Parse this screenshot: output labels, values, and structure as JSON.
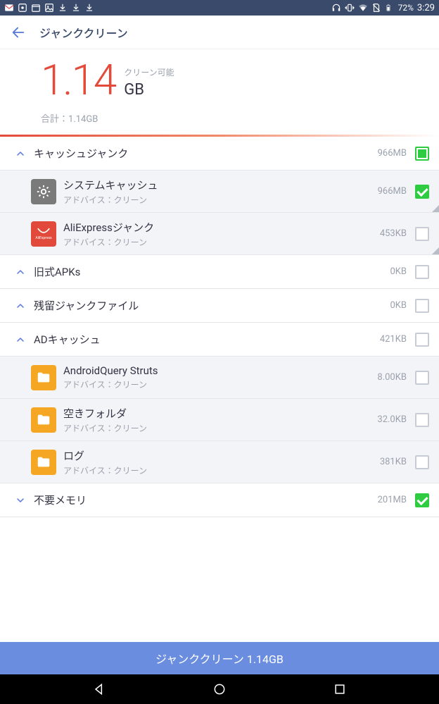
{
  "status_bar": {
    "battery_pct": "72%",
    "clock": "3:29"
  },
  "header": {
    "title": "ジャンククリーン"
  },
  "summary": {
    "big_number": "1.14",
    "cleanable_label": "クリーン可能",
    "unit": "GB",
    "total_label": "合計：",
    "total_value": "1.14GB"
  },
  "advice_text": "アドバイス：クリーン",
  "categories": [
    {
      "id": "cache",
      "label": "キャッシュジャンク",
      "size": "966MB",
      "expanded": true,
      "check": "partial",
      "items": [
        {
          "id": "system-cache",
          "icon": "gear",
          "label": "システムキャッシュ",
          "size": "966MB",
          "check": "checked",
          "tri": true
        },
        {
          "id": "aliexpress",
          "icon": "ali",
          "label": "AliExpressジャンク",
          "size": "453KB",
          "check": "unchecked",
          "tri": true
        }
      ]
    },
    {
      "id": "old-apks",
      "label": "旧式APKs",
      "size": "0KB",
      "expanded": true,
      "check": "unchecked",
      "items": []
    },
    {
      "id": "residual",
      "label": "残留ジャンクファイル",
      "size": "0KB",
      "expanded": true,
      "check": "unchecked",
      "items": []
    },
    {
      "id": "ad-cache",
      "label": "ADキャッシュ",
      "size": "421KB",
      "expanded": true,
      "check": "unchecked",
      "items": [
        {
          "id": "aq-struts",
          "icon": "folder",
          "label": "AndroidQuery Struts",
          "size": "8.00KB",
          "check": "unchecked"
        },
        {
          "id": "empty-folder",
          "icon": "folder",
          "label": "空きフォルダ",
          "size": "32.0KB",
          "check": "unchecked"
        },
        {
          "id": "log",
          "icon": "folder",
          "label": "ログ",
          "size": "381KB",
          "check": "unchecked"
        }
      ]
    },
    {
      "id": "unused-mem",
      "label": "不要メモリ",
      "size": "201MB",
      "expanded": false,
      "check": "checked",
      "items": []
    }
  ],
  "action_button": "ジャンククリーン 1.14GB"
}
